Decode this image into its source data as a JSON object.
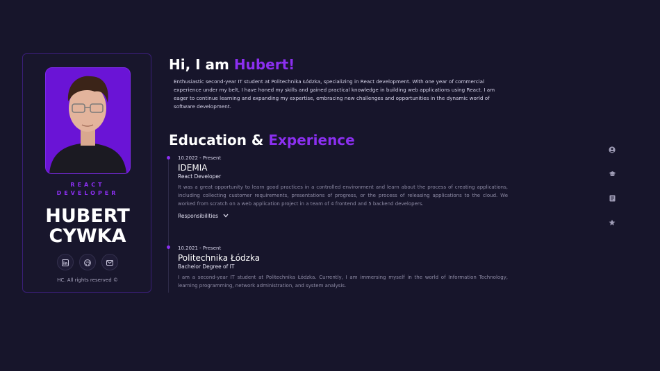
{
  "profile": {
    "role_line1": "REACT",
    "role_line2": "DEVELOPER",
    "first_name": "HUBERT",
    "last_name": "CYWKA",
    "copyright": "HC. All rights reserved ©"
  },
  "socials": [
    "linkedin-icon",
    "github-icon",
    "email-icon"
  ],
  "hero": {
    "greeting": "Hi, I am ",
    "name": "Hubert!",
    "intro": "Enthusiastic second-year IT student at Politechnika Łódzka, specializing in React development. With one year of commercial experience under my belt, I have honed my skills and gained practical knowledge in building web applications using React. I am eager to continue learning and expanding my expertise, embracing new challenges and opportunities in the dynamic world of software development."
  },
  "section": {
    "title_part1": "Education & ",
    "title_part2": "Experience"
  },
  "timeline": [
    {
      "date": "10.2022 - Present",
      "org": "IDEMIA",
      "position": "React Developer",
      "description": "It was a great opportunity to learn good practices in a controlled environment and learn about the process of creating applications, including collecting customer requirements, presentations of progress, or the process of releasing applications to the cloud. We worked from scratch on a web application project in a team of 4 frontend and 5 backend developers.",
      "toggle_label": "Responsibilities"
    },
    {
      "date": "10.2021 - Present",
      "org": "Politechnika Łódzka",
      "position": "Bachelor Degree of IT",
      "description": "I am a second-year IT student at Politechnika Łódzka. Currently, I am immersing myself in the world of Information Technology, learning programming, network administration, and system analysis."
    }
  ],
  "side_nav": [
    "user-icon",
    "graduation-cap-icon",
    "document-icon",
    "star-icon"
  ],
  "colors": {
    "background": "#17152b",
    "accent": "#8b2ff0"
  }
}
